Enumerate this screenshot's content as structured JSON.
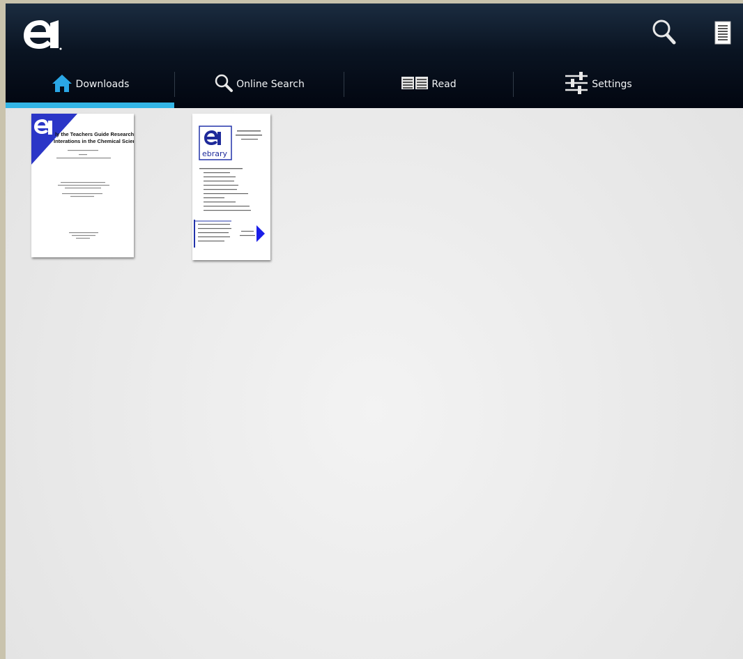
{
  "app": {
    "logo_icon": "ebrary-e-logo",
    "actions": [
      {
        "name": "search",
        "icon": "search-icon"
      },
      {
        "name": "menu",
        "icon": "document-list-icon"
      }
    ]
  },
  "tabs": [
    {
      "label": "Downloads",
      "icon": "home-icon",
      "selected": true
    },
    {
      "label": "Online Search",
      "icon": "search-icon",
      "selected": false
    },
    {
      "label": "Read",
      "icon": "open-book-icon",
      "selected": false
    },
    {
      "label": "Settings",
      "icon": "sliders-icon",
      "selected": false
    }
  ],
  "colors": {
    "accent": "#33b5e5",
    "action_bar": "#0a1422",
    "cover_blue": "#2b36c7",
    "arrow_blue": "#1a1ee8"
  },
  "books": [
    {
      "cover_title": "ly the Teachers Guide Research\nInterations in the Chemical Sciences"
    },
    {
      "logo_text": "ebrary"
    }
  ]
}
